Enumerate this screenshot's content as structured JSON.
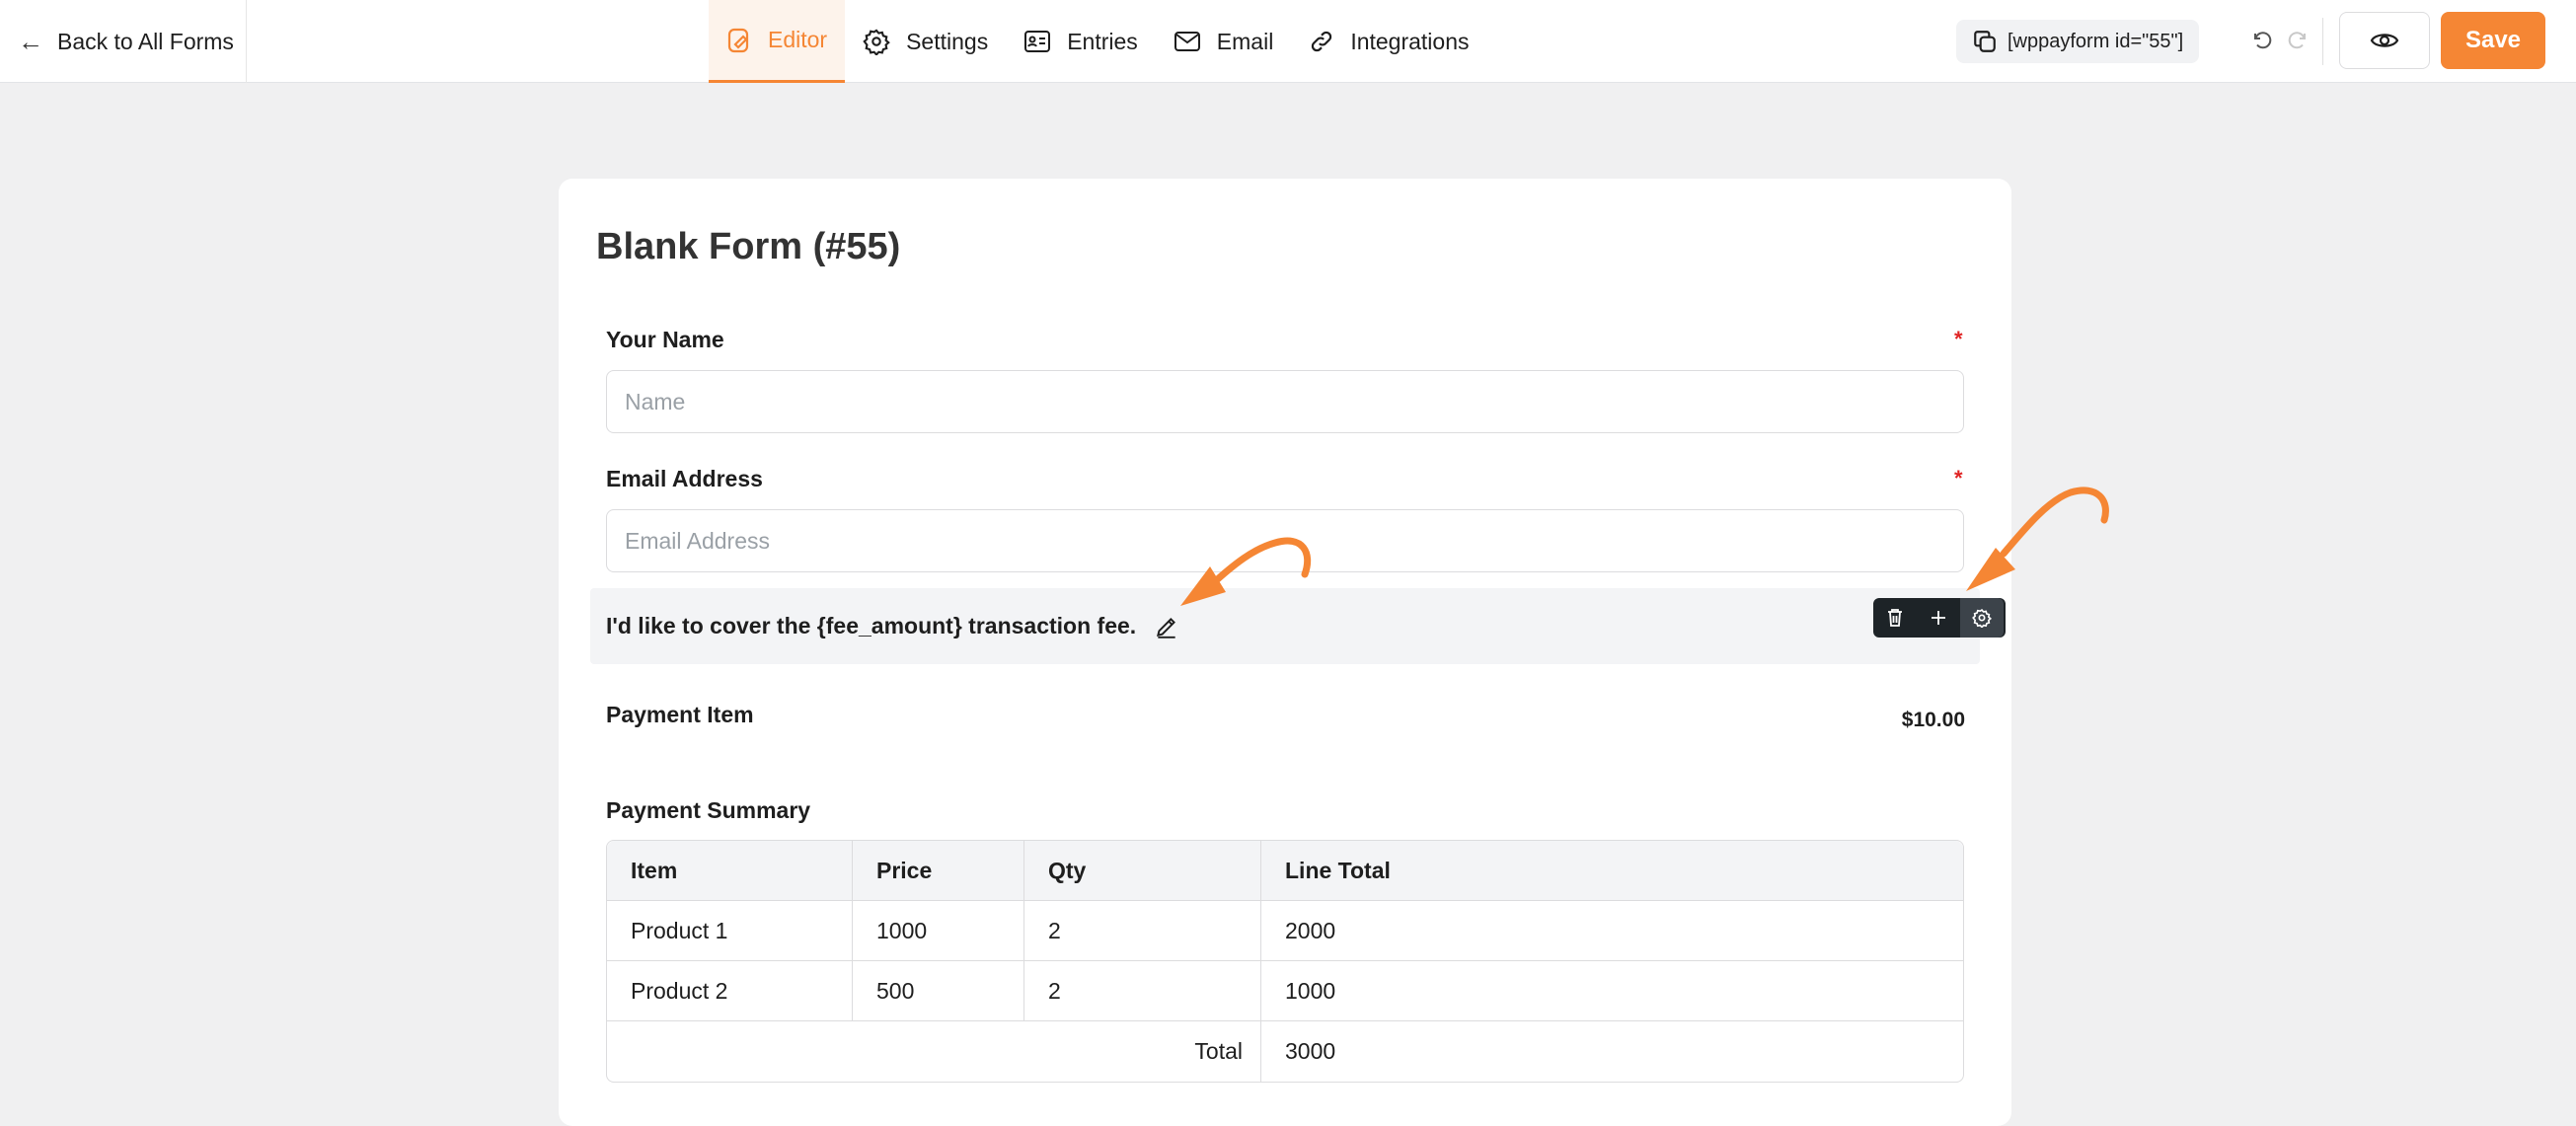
{
  "header": {
    "back_label": "Back to All Forms",
    "tabs": [
      {
        "label": "Editor",
        "icon": "editor-icon",
        "active": true
      },
      {
        "label": "Settings",
        "icon": "gear-icon",
        "active": false
      },
      {
        "label": "Entries",
        "icon": "entries-icon",
        "active": false
      },
      {
        "label": "Email",
        "icon": "envelope-icon",
        "active": false
      },
      {
        "label": "Integrations",
        "icon": "link-icon",
        "active": false
      }
    ],
    "shortcode": "[wppayform id=\"55\"]",
    "save_label": "Save",
    "accent_color": "#f58634"
  },
  "form": {
    "title": "Blank Form (#55)",
    "name_field": {
      "label": "Your Name",
      "placeholder": "Name",
      "required_mark": "*"
    },
    "email_field": {
      "label": "Email Address",
      "placeholder": "Email Address",
      "required_mark": "*"
    },
    "fee_checkbox": {
      "label": "I'd like to cover the {fee_amount} transaction fee."
    },
    "payment_item": {
      "label": "Payment Item",
      "price": "$10.00"
    },
    "payment_summary": {
      "label": "Payment Summary",
      "columns": [
        "Item",
        "Price",
        "Qty",
        "Line Total"
      ],
      "rows": [
        [
          "Product 1",
          "1000",
          "2",
          "2000"
        ],
        [
          "Product 2",
          "500",
          "2",
          "1000"
        ]
      ],
      "total_label": "Total",
      "total_value": "3000"
    }
  },
  "annotation_color": "#f58634"
}
